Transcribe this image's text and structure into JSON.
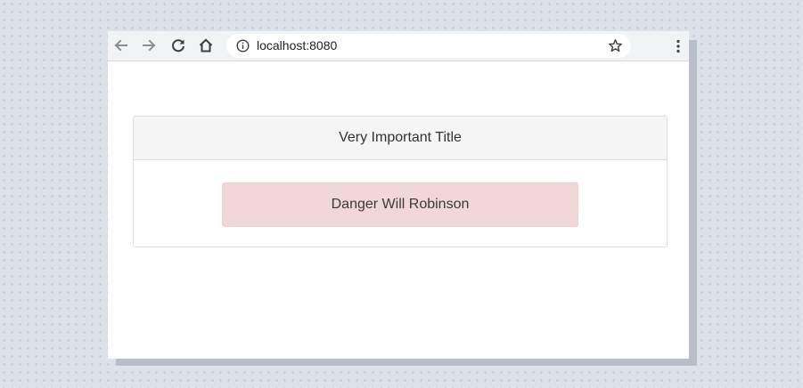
{
  "browser": {
    "url": "localhost:8080",
    "toolbar_icons": {
      "back": "arrow-left-icon",
      "forward": "arrow-right-icon",
      "reload": "reload-icon",
      "home": "home-icon",
      "site_info": "info-circle-icon",
      "bookmark": "star-outline-icon",
      "menu": "kebab-menu-icon"
    }
  },
  "page": {
    "panel_title": "Very Important Title",
    "alert_text": "Danger Will Robinson"
  },
  "colors": {
    "panel_heading_bg": "#f5f5f5",
    "alert_bg": "#f2d7d9",
    "toolbar_bg": "#f1f3f4"
  }
}
